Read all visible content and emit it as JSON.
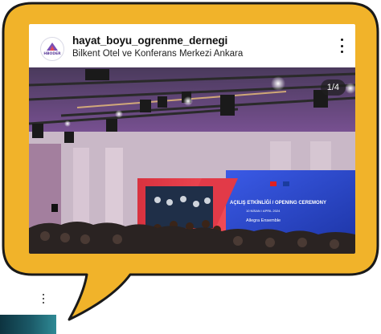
{
  "post": {
    "username": "hayat_boyu_ogrenme_dernegi",
    "location": "Bilkent Otel ve Konferans Merkezi Ankara",
    "avatar_label": "HBODER",
    "image_counter": "1/4"
  },
  "stage_screen": {
    "title": "AÇILIŞ ETKİNLİĞİ / OPENING CEREMONY",
    "date": "10 NİSAN / APRIL 2024",
    "subtitle": "Allegra Ensemble"
  },
  "colors": {
    "bubble_fill": "#F1B32A",
    "bubble_outline": "#1A1A1A",
    "stage_red": "#E23A48",
    "stage_blue": "#2E4FD6",
    "ceiling_purple": "#7C4C9C"
  }
}
